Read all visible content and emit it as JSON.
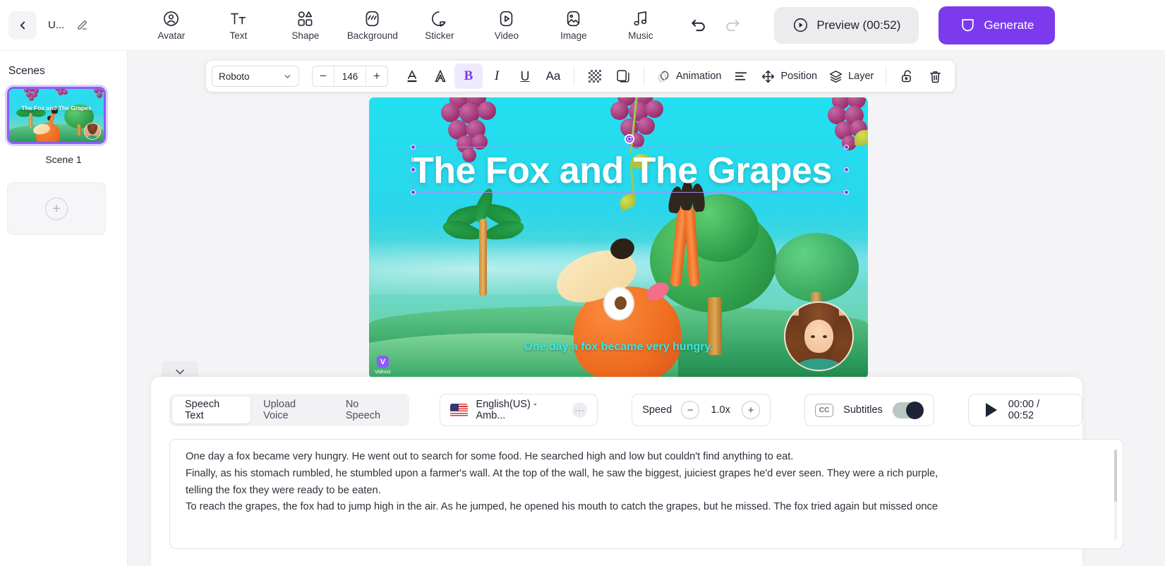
{
  "topbar": {
    "back_icon": "chevron-left-icon",
    "project_title": "U...",
    "edit_icon": "pencil-icon",
    "tools": [
      {
        "label": "Avatar",
        "icon": "avatar-icon"
      },
      {
        "label": "Text",
        "icon": "text-icon"
      },
      {
        "label": "Shape",
        "icon": "shape-icon"
      },
      {
        "label": "Background",
        "icon": "background-icon"
      },
      {
        "label": "Sticker",
        "icon": "sticker-icon"
      },
      {
        "label": "Video",
        "icon": "video-icon"
      },
      {
        "label": "Image",
        "icon": "image-icon"
      },
      {
        "label": "Music",
        "icon": "music-icon"
      }
    ],
    "undo_icon": "undo-icon",
    "redo_icon": "redo-icon",
    "preview_label": "Preview (00:52)",
    "generate_label": "Generate",
    "accent_color": "#7c3aed"
  },
  "sidebar": {
    "title": "Scenes",
    "scenes": [
      {
        "label": "Scene 1",
        "thumb_title": "The Fox and The Grapes",
        "selected": true
      }
    ],
    "add_scene_label": "+"
  },
  "format_toolbar": {
    "font_family": "Roboto",
    "font_size": "146",
    "decrease_label": "−",
    "increase_label": "+",
    "buttons": [
      {
        "name": "font-color-icon",
        "label": "A"
      },
      {
        "name": "text-outline-icon",
        "label": "A"
      },
      {
        "name": "bold-icon",
        "label": "B",
        "active": true
      },
      {
        "name": "italic-icon",
        "label": "I"
      },
      {
        "name": "underline-icon",
        "label": "U"
      },
      {
        "name": "text-case-icon",
        "label": "Aa"
      }
    ],
    "opacity_icon": "opacity-checker-icon",
    "shadow_icon": "shadow-duplicate-icon",
    "animation_label": "Animation",
    "align_icon": "align-left-icon",
    "position_label": "Position",
    "layer_label": "Layer",
    "lock_icon": "unlock-icon",
    "delete_icon": "trash-icon"
  },
  "canvas": {
    "title_text": "The Fox and The Grapes",
    "subtitle_text": "One day a fox became very hungry.",
    "watermark_logo": "V",
    "watermark_text": "Vidnoz"
  },
  "collapse": {
    "icon": "chevron-down-icon"
  },
  "bottom_panel": {
    "tabs": [
      {
        "label": "Speech Text",
        "active": true
      },
      {
        "label": "Upload Voice",
        "active": false
      },
      {
        "label": "No Speech",
        "active": false
      }
    ],
    "voice": {
      "flag": "us-flag-icon",
      "label": "English(US) - Amb...",
      "more_label": "···"
    },
    "speed": {
      "label": "Speed",
      "value": "1.0x",
      "minus": "−",
      "plus": "+"
    },
    "subtitles": {
      "icon_label": "CC",
      "label": "Subtitles",
      "enabled": true
    },
    "playback": {
      "icon": "play-icon",
      "time": "00:00 / 00:52"
    },
    "script_lines": [
      "One day a fox became very hungry. He went out to search for some food. He searched high and low but couldn't find anything to eat.",
      "Finally, as his stomach rumbled, he stumbled upon a farmer's wall. At the top of the wall, he saw the biggest, juiciest grapes he'd ever seen. They were a rich purple,",
      "telling the fox they were ready to be eaten.",
      "To reach the grapes, the fox had to jump high in the air. As he jumped, he opened his mouth to catch the grapes, but he missed. The fox tried again but missed once"
    ]
  }
}
